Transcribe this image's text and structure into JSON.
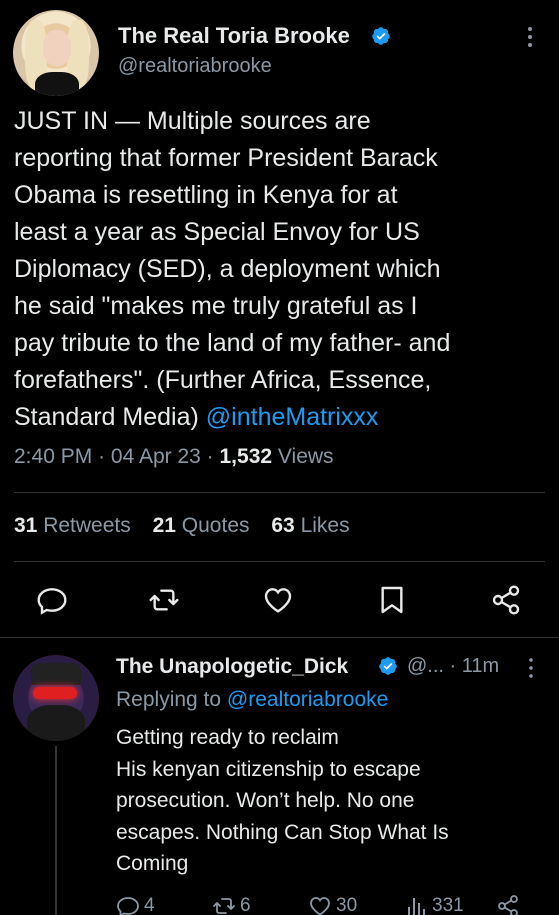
{
  "tweet": {
    "author_name": "The Real Toria Brooke",
    "author_handle": "@realtoriabrooke",
    "verified": true,
    "text_lines": [
      "JUST IN — Multiple sources are",
      "reporting that former President Barack",
      "Obama is resettling in Kenya for at",
      "least a year as Special Envoy for US",
      "Diplomacy (SED), a deployment which",
      "he said \"makes me truly grateful as I",
      "pay tribute to the land of my father- and",
      "forefathers\". (Further Africa, Essence,",
      "Standard Media)"
    ],
    "mention": "@intheMatrixxx",
    "time": "2:40 PM",
    "date": "04 Apr 23",
    "views_count": "1,532",
    "views_label": "Views",
    "retweets_count": "31",
    "retweets_label": "Retweets",
    "quotes_count": "21",
    "quotes_label": "Quotes",
    "likes_count": "63",
    "likes_label": "Likes",
    "separator": "·"
  },
  "actions": [
    "reply-icon",
    "retweet-icon",
    "like-icon",
    "bookmark-icon",
    "share-icon"
  ],
  "reply": {
    "author_name": "The Unapologetic_Dick",
    "handle_truncated": "@...",
    "time": "11m",
    "verified": true,
    "replying_prefix": "Replying to",
    "replying_to": "@realtoriabrooke",
    "text_lines": [
      "Getting ready to reclaim",
      "His kenyan citizenship to escape",
      "prosecution. Won’t help. No one",
      "escapes. Nothing Can Stop What Is",
      "Coming"
    ],
    "reply_count": "4",
    "retweet_count": "6",
    "like_count": "30",
    "views_count": "331"
  },
  "colors": {
    "background": "#000000",
    "text": "#e7e9ea",
    "secondary": "#8b98a5",
    "accent": "#1d9bf0",
    "divider": "#2f3336"
  }
}
